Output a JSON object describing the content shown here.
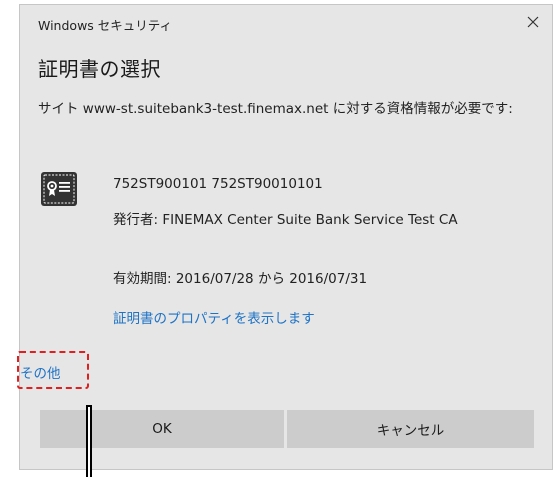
{
  "window": {
    "title": "Windows セキュリティ"
  },
  "heading": "証明書の選択",
  "message": "サイト www-st.suitebank3-test.finemax.net に対する資格情報が必要です:",
  "certificate": {
    "icon": "certificate-icon",
    "name": "752ST900101 752ST90010101",
    "issuer": "発行者: FINEMAX Center Suite Bank Service Test CA",
    "validity": "有効期間: 2016/07/28 から 2016/07/31",
    "properties_link": "証明書のプロパティを表示します"
  },
  "more_choices_link": "その他",
  "buttons": {
    "ok": "OK",
    "cancel": "キャンセル"
  },
  "colors": {
    "dialog_bg": "#e6e6e6",
    "link": "#1e73c7",
    "button_bg": "#cccccc",
    "highlight": "#e02020"
  }
}
